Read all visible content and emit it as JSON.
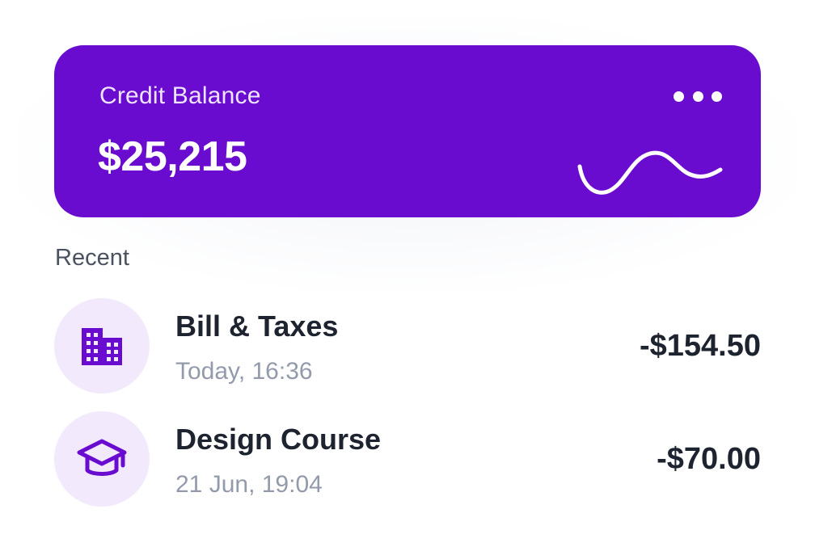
{
  "card": {
    "label": "Credit Balance",
    "amount": "$25,215",
    "more_icon": "more-horizontal-icon",
    "sparkline_icon": "wave-sparkline",
    "background_color": "#6a0ccf"
  },
  "recent": {
    "label": "Recent",
    "items": [
      {
        "title": "Bill & Taxes",
        "time": "Today, 16:36",
        "amount": "-$154.50",
        "icon": "building-icon"
      },
      {
        "title": "Design Course",
        "time": "21 Jun, 19:04",
        "amount": "-$70.00",
        "icon": "graduation-cap-icon"
      }
    ]
  },
  "colors": {
    "accent": "#6a0ccf",
    "icon_background": "#f3e9fd",
    "text_primary": "#1e2330",
    "text_secondary": "#939aab"
  }
}
